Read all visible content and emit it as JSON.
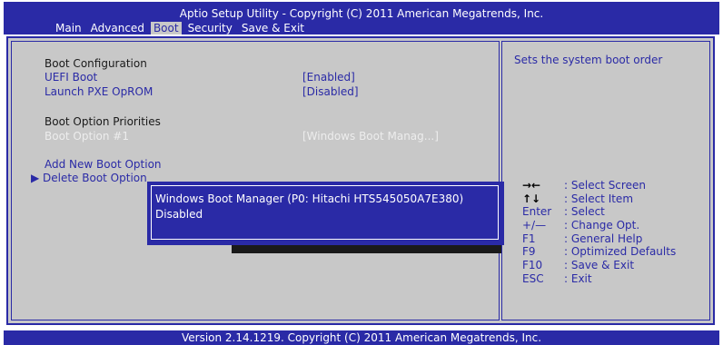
{
  "header": {
    "title": "Aptio Setup Utility - Copyright (C) 2011 American Megatrends, Inc.",
    "tabs": [
      "Main",
      "Advanced",
      "Boot",
      "Security",
      "Save & Exit"
    ],
    "active_tab": "Boot"
  },
  "boot": {
    "section_config": "Boot Configuration",
    "uefi_boot_label": "UEFI Boot",
    "uefi_boot_value": "[Enabled]",
    "pxe_label": "Launch PXE OpROM",
    "pxe_value": "[Disabled]",
    "priorities_header": "Boot Option Priorities",
    "boot_option1_label": "Boot Option #1",
    "boot_option1_value": "[Windows Boot Manag...]",
    "add_label": "Add New Boot Option",
    "delete_label": "Delete Boot Option",
    "selection_marker": "▶"
  },
  "help": {
    "text": "Sets the system boot order",
    "legend": [
      {
        "key": "→←",
        "desc": ": Select Screen"
      },
      {
        "key": "↑↓",
        "desc": ": Select Item"
      },
      {
        "key": "Enter",
        "desc": ": Select"
      },
      {
        "key": "+/—",
        "desc": ": Change Opt."
      },
      {
        "key": "F1",
        "desc": ": General Help"
      },
      {
        "key": "F9",
        "desc": ": Optimized Defaults"
      },
      {
        "key": "F10",
        "desc": ": Save & Exit"
      },
      {
        "key": "ESC",
        "desc": ": Exit"
      }
    ]
  },
  "popup": {
    "options": [
      "Windows Boot Manager (P0: Hitachi HTS545050A7E380)",
      "Disabled"
    ]
  },
  "footer": {
    "text": "Version 2.14.1219. Copyright (C) 2011 American Megatrends, Inc."
  },
  "colors": {
    "bios_blue": "#2a2aa6",
    "panel_gray": "#c8c8c8",
    "text_white": "#ffffff"
  }
}
